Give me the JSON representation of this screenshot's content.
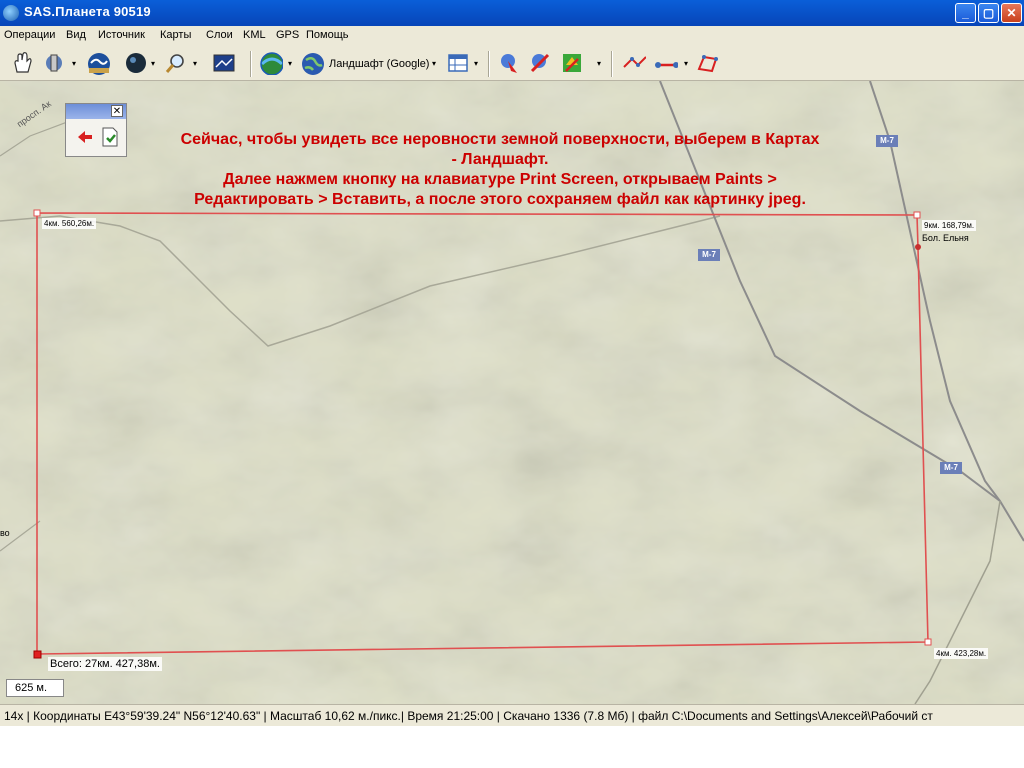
{
  "window": {
    "title": "SAS.Планета 90519",
    "minimize": "_",
    "maximize": "▢",
    "close": "✕"
  },
  "menu": [
    "Операции",
    "Вид",
    "Источник",
    "Карты",
    "Слои",
    "KML",
    "GPS",
    "Помощь"
  ],
  "toolbar": {
    "map_source": "Ландшафт (Google)",
    "dropdown_arrow": "▾"
  },
  "instruction": [
    "Сейчас, чтобы увидеть все неровности земной поверхности, выберем в Картах",
    "- Ландшафт.",
    "Далее нажмем кнопку на клавиатуре Print Screen, открываем Paints >",
    "Редактировать > Вставить, а после этого сохраняем файл как картинку jpeg."
  ],
  "measure": {
    "p1": "4км. 560,26м.",
    "p2": "9км. 168,79м.",
    "p3": "4км. 423,28м.",
    "total": "Всего: 27км. 427,38м."
  },
  "places": {
    "elnya": "Бол. Ельня",
    "prospekt": "просп. Ак",
    "vo": "во"
  },
  "road_signs": [
    "M-7",
    "M-7",
    "M-7"
  ],
  "scale": "625 м.",
  "status": "14x | Координаты E43°59'39.24\" N56°12'40.63\" | Масштаб 10,62 м./пикс.| Время 21:25:00 | Скачано 1336 (7.8 Мб) | файл C:\\Documents and Settings\\Алексей\\Рабочий ст",
  "colors": {
    "measure_line": "#e05050",
    "map_bg": "#dedfc5",
    "instruction_text": "#cc0000",
    "road": "#9a9a9a"
  }
}
